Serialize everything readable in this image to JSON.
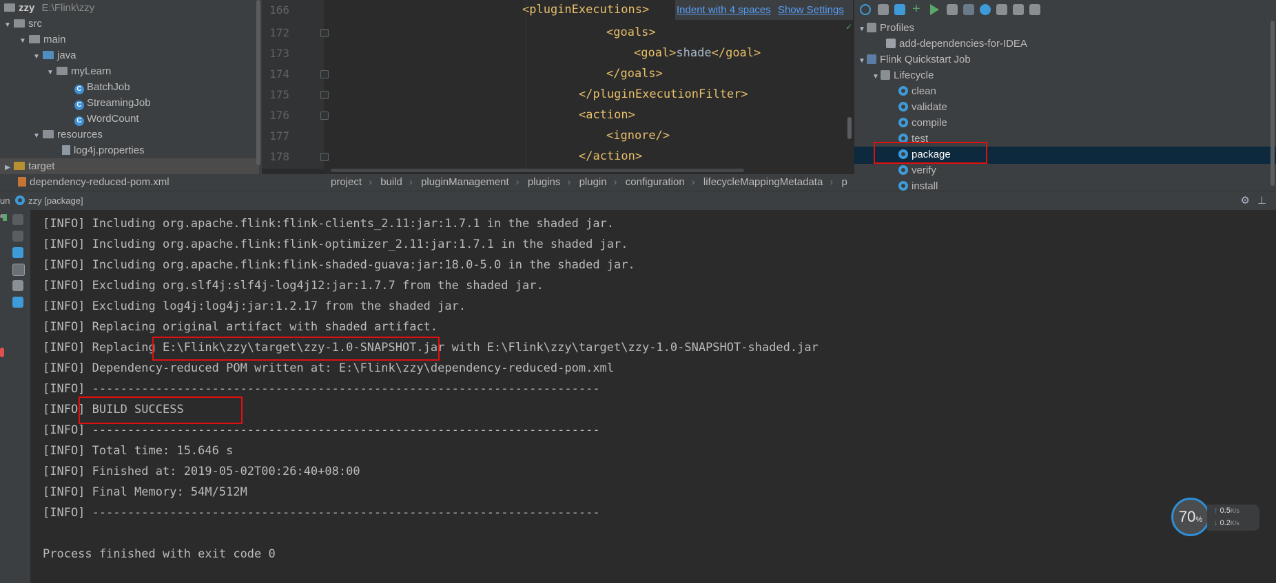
{
  "project": {
    "root": {
      "name": "zzy",
      "path": "E:\\Flink\\zzy"
    },
    "items": [
      {
        "label": "src"
      },
      {
        "label": "main"
      },
      {
        "label": "java"
      },
      {
        "label": "myLearn"
      },
      {
        "label": "BatchJob",
        "icon": "C"
      },
      {
        "label": "StreamingJob",
        "icon": "C"
      },
      {
        "label": "WordCount",
        "icon": "C"
      },
      {
        "label": "resources"
      },
      {
        "label": "log4j.properties"
      },
      {
        "label": "target"
      },
      {
        "label": "dependency-reduced-pom.xml"
      }
    ]
  },
  "editor": {
    "top_line": {
      "num": "166",
      "code": "<pluginExecutions>"
    },
    "hint": {
      "indent": "Indent with 4 spaces",
      "settings": "Show Settings"
    },
    "lines": [
      {
        "num": "172",
        "open": "<goals>",
        "inner": "",
        "close": ""
      },
      {
        "num": "173",
        "open": "<goal>",
        "inner": "shade",
        "close": "</goal>"
      },
      {
        "num": "174",
        "open": "</goals>",
        "inner": "",
        "close": ""
      },
      {
        "num": "175",
        "open": "</pluginExecutionFilter>",
        "inner": "",
        "close": ""
      },
      {
        "num": "176",
        "open": "<action>",
        "inner": "",
        "close": ""
      },
      {
        "num": "177",
        "open": "<ignore/>",
        "inner": "",
        "close": ""
      },
      {
        "num": "178",
        "open": "</action>",
        "inner": "",
        "close": ""
      }
    ],
    "breadcrumbs": [
      "project",
      "build",
      "pluginManagement",
      "plugins",
      "plugin",
      "configuration",
      "lifecycleMappingMetadata",
      "p"
    ]
  },
  "maven": {
    "profiles_label": "Profiles",
    "profile_item": "add-dependencies-for-IDEA",
    "project_label": "Flink Quickstart Job",
    "lifecycle_label": "Lifecycle",
    "phases": [
      "clean",
      "validate",
      "compile",
      "test",
      "package",
      "verify",
      "install"
    ],
    "selected_phase": "package"
  },
  "run": {
    "header_prefix": "un",
    "tab_label": "zzy [package]"
  },
  "console": {
    "lines": [
      "[INFO] Including org.apache.flink:flink-clients_2.11:jar:1.7.1 in the shaded jar.",
      "[INFO] Including org.apache.flink:flink-optimizer_2.11:jar:1.7.1 in the shaded jar.",
      "[INFO] Including org.apache.flink:flink-shaded-guava:jar:18.0-5.0 in the shaded jar.",
      "[INFO] Excluding org.slf4j:slf4j-log4j12:jar:1.7.7 from the shaded jar.",
      "[INFO] Excluding log4j:log4j:jar:1.2.17 from the shaded jar.",
      "[INFO] Replacing original artifact with shaded artifact.",
      "[INFO] Replacing E:\\Flink\\zzy\\target\\zzy-1.0-SNAPSHOT.jar with E:\\Flink\\zzy\\target\\zzy-1.0-SNAPSHOT-shaded.jar",
      "[INFO] Dependency-reduced POM written at: E:\\Flink\\zzy\\dependency-reduced-pom.xml",
      "[INFO] ------------------------------------------------------------------------",
      "[INFO] BUILD SUCCESS",
      "[INFO] ------------------------------------------------------------------------",
      "[INFO] Total time: 15.646 s",
      "[INFO] Finished at: 2019-05-02T00:26:40+08:00",
      "[INFO] Final Memory: 54M/512M",
      "[INFO] ------------------------------------------------------------------------",
      "",
      "Process finished with exit code 0"
    ]
  },
  "widget": {
    "percent": "70",
    "percent_unit": "%",
    "up_speed": "0.5",
    "down_speed": "0.2",
    "speed_unit": "K/s"
  },
  "colors": {
    "highlight_box": "#e01010",
    "maven_selection": "#0d293e",
    "link": "#589df6",
    "xml_tag": "#e8bf6a"
  }
}
